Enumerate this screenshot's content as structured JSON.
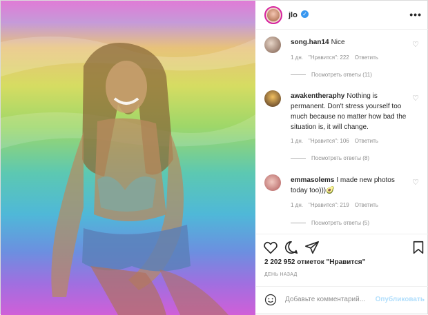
{
  "post": {
    "username": "jlo",
    "verified": true
  },
  "comments": [
    {
      "username": "song.han14",
      "text": "Nice",
      "age": "1 дн.",
      "likes": "\"Нравится\": 222",
      "reply": "Ответить",
      "view_replies": "Посмотреть ответы (11)"
    },
    {
      "username": "awakentheraphy",
      "text": "Nothing is permanent. Don't stress yourself too much because no matter how bad the situation is, it will change.",
      "age": "1 дн.",
      "likes": "\"Нравится\": 106",
      "reply": "Ответить",
      "view_replies": "Посмотреть ответы (8)"
    },
    {
      "username": "emmasolems",
      "text": "I made new photos today too)))🥑",
      "age": "1 дн.",
      "likes": "\"Нравится\": 219",
      "reply": "Ответить",
      "view_replies": "Посмотреть ответы (5)"
    }
  ],
  "likes_count": "2 202 952 отметок \"Нравится\"",
  "time": "ДЕНЬ НАЗАД",
  "comment_box": {
    "placeholder": "Добавьте комментарий...",
    "publish_label": "Опубликовать"
  },
  "colors": {
    "link_blue": "#3897f0",
    "publish_blue_disabled": "#b2dffc",
    "muted_text": "#8e8e8e"
  },
  "icons": [
    "more-options-icon",
    "heart-icon",
    "comment-icon",
    "share-icon",
    "bookmark-icon",
    "emoji-icon",
    "verified-badge-icon"
  ]
}
